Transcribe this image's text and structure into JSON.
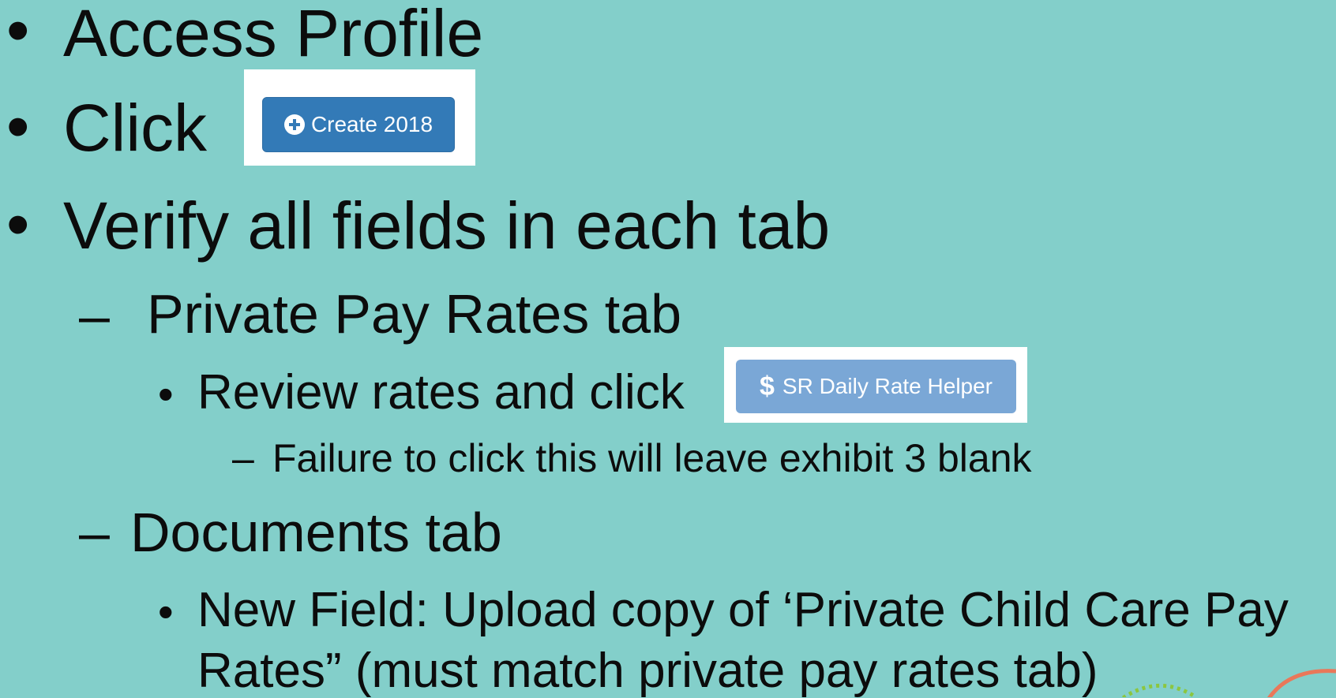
{
  "bullets": {
    "access_profile": "Access Profile",
    "click": "Click",
    "verify": "Verify all fields in each tab",
    "private_pay_tab": "Private Pay Rates tab",
    "review_rates": "Review rates and click",
    "failure_note": "Failure to click this will leave exhibit 3 blank",
    "documents_tab": "Documents tab",
    "new_field_line1": "New Field: Upload copy of ‘Private Child Care Pay",
    "new_field_line2": "Rates” (must match private pay rates tab)"
  },
  "markers": {
    "bullet": "•",
    "dash": "–"
  },
  "buttons": {
    "create_label": "Create 2018",
    "create_icon": "plus-circle-icon",
    "rate_helper_label": "SR Daily Rate Helper",
    "rate_helper_icon_glyph": "$"
  },
  "colors": {
    "background": "#83cfca",
    "create_button": "#337ab7",
    "rate_helper_button": "#7aa7d6",
    "text": "#0c0c0c"
  }
}
